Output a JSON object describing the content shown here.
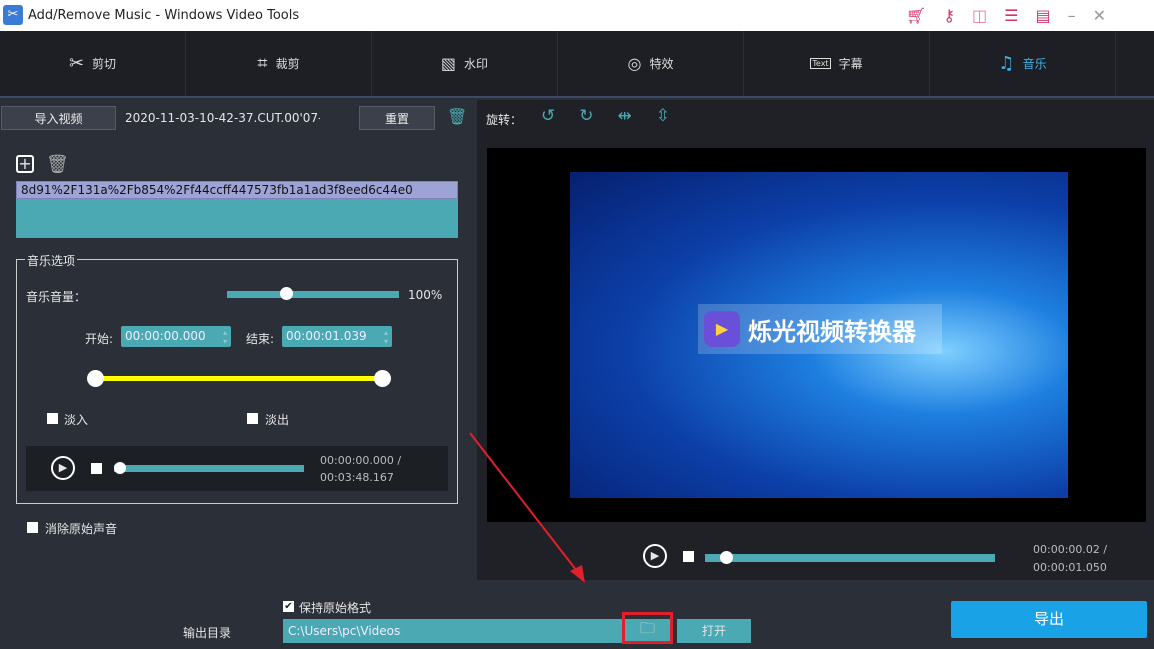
{
  "window": {
    "title": "Add/Remove Music - Windows Video Tools"
  },
  "tabs": [
    {
      "label": "剪切",
      "icon": "scissors-icon"
    },
    {
      "label": "裁剪",
      "icon": "crop-icon"
    },
    {
      "label": "水印",
      "icon": "watermark-icon"
    },
    {
      "label": "特效",
      "icon": "effects-icon"
    },
    {
      "label": "字幕",
      "icon": "text-icon",
      "icon_text": "Text"
    },
    {
      "label": "音乐",
      "icon": "music-icon",
      "active": true
    }
  ],
  "left": {
    "import_label": "导入视频",
    "file_name": "2020-11-03-10-42-37.CUT.00'07-(",
    "reset_label": "重置",
    "music_list": [
      "8d91%2F131a%2Fb854%2Ff44ccff447573fb1a1ad3f8eed6c44e0"
    ],
    "options_title": "音乐选项",
    "volume_label": "音乐音量：",
    "volume_value": "100%",
    "volume_fraction": 0.35,
    "start_label": "开始:",
    "start_value": "00:00:00.000",
    "end_label": "结束:",
    "end_value": "00:00:01.039",
    "fade_in": "淡入",
    "fade_out": "淡出",
    "player_time": "00:00:00.000 /",
    "player_total": "00:03:48.167",
    "remove_original": "消除原始声音"
  },
  "right": {
    "rotate_label": "旋转：",
    "preview_logo_text": "烁光视频转换器",
    "player_time": "00:00:00.02 /",
    "player_total": "00:00:01.050"
  },
  "bottom": {
    "keep_format": "保持原始格式",
    "output_label": "输出目录",
    "output_path": "C:\\Users\\pc\\Videos",
    "open_label": "打开",
    "export_label": "导出"
  },
  "colors": {
    "accent": "#3fb1e4",
    "teal": "#4aa9b3",
    "yellow": "#ffff00",
    "highlight": "#e0202a"
  }
}
